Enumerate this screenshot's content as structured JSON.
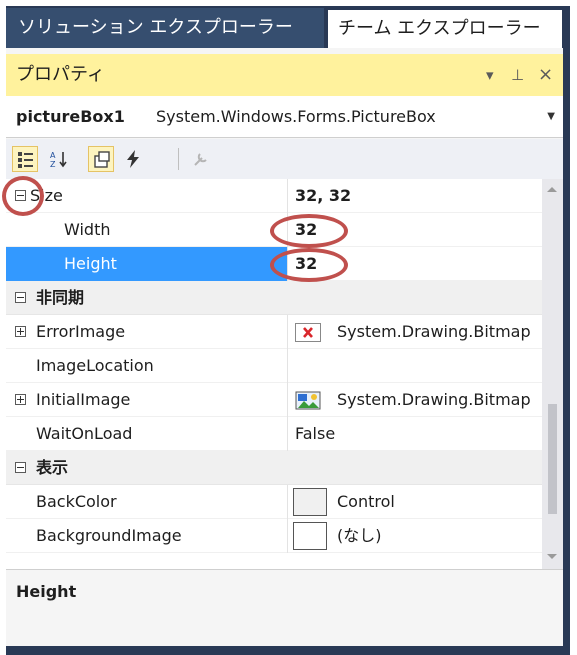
{
  "tabs": {
    "solution_explorer": "ソリューション エクスプローラー",
    "team_explorer": "チーム エクスプローラー"
  },
  "properties_window": {
    "title": "プロパティ",
    "dropdown_icon": "▾",
    "pin_icon": "⊥",
    "close_icon": "×"
  },
  "object_selector": {
    "name": "pictureBox1",
    "type": "System.Windows.Forms.PictureBox"
  },
  "toolbar": {
    "items": [
      "categorized-icon",
      "alphabetical-icon",
      "properties-icon",
      "events-icon",
      "property-pages-icon"
    ]
  },
  "grid": {
    "size_name": "Size",
    "size_value": "32, 32",
    "width_name": "Width",
    "width_value": "32",
    "height_name": "Height",
    "height_value": "32",
    "category_async": "非同期",
    "errorimage_name": "ErrorImage",
    "errorimage_value": "System.Drawing.Bitmap",
    "imagelocation_name": "ImageLocation",
    "imagelocation_value": "",
    "initialimage_name": "InitialImage",
    "initialimage_value": "System.Drawing.Bitmap",
    "waitonload_name": "WaitOnLoad",
    "waitonload_value": "False",
    "category_display": "表示",
    "backcolor_name": "BackColor",
    "backcolor_value": "Control",
    "backgroundimage_name": "BackgroundImage",
    "backgroundimage_value": "(なし)"
  },
  "description": {
    "title": "Height"
  },
  "colors": {
    "frame": "#293955",
    "title_bar": "#fff29d",
    "selection": "#3399ff",
    "annotation": "#c0504d"
  }
}
